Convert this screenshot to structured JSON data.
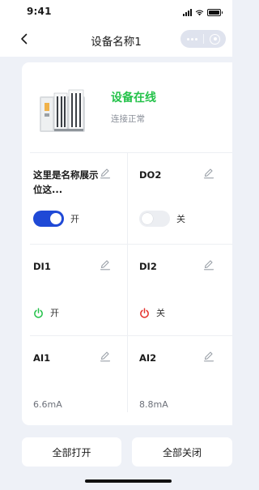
{
  "status_bar": {
    "time": "9:41"
  },
  "nav": {
    "title": "设备名称1"
  },
  "device": {
    "status": "设备在线",
    "status_color": "#24c24a",
    "sub": "连接正常"
  },
  "cells": {
    "do1": {
      "name": "这里是名称展示位这...",
      "state_label": "开",
      "state": "on"
    },
    "do2": {
      "name": "DO2",
      "state_label": "关",
      "state": "off"
    },
    "di1": {
      "name": "DI1",
      "state_label": "开",
      "state": "on",
      "icon_color": "#24c24a"
    },
    "di2": {
      "name": "DI2",
      "state_label": "关",
      "state": "off",
      "icon_color": "#e5322d"
    },
    "ai1": {
      "name": "AI1",
      "value": "6.6mA"
    },
    "ai2": {
      "name": "AI2",
      "value": "8.8mA"
    }
  },
  "buttons": {
    "all_on": "全部打开",
    "all_off": "全部关闭"
  },
  "colors": {
    "accent": "#1f49d6",
    "online": "#24c24a",
    "off_red": "#e5322d",
    "background": "#eef1f7"
  }
}
